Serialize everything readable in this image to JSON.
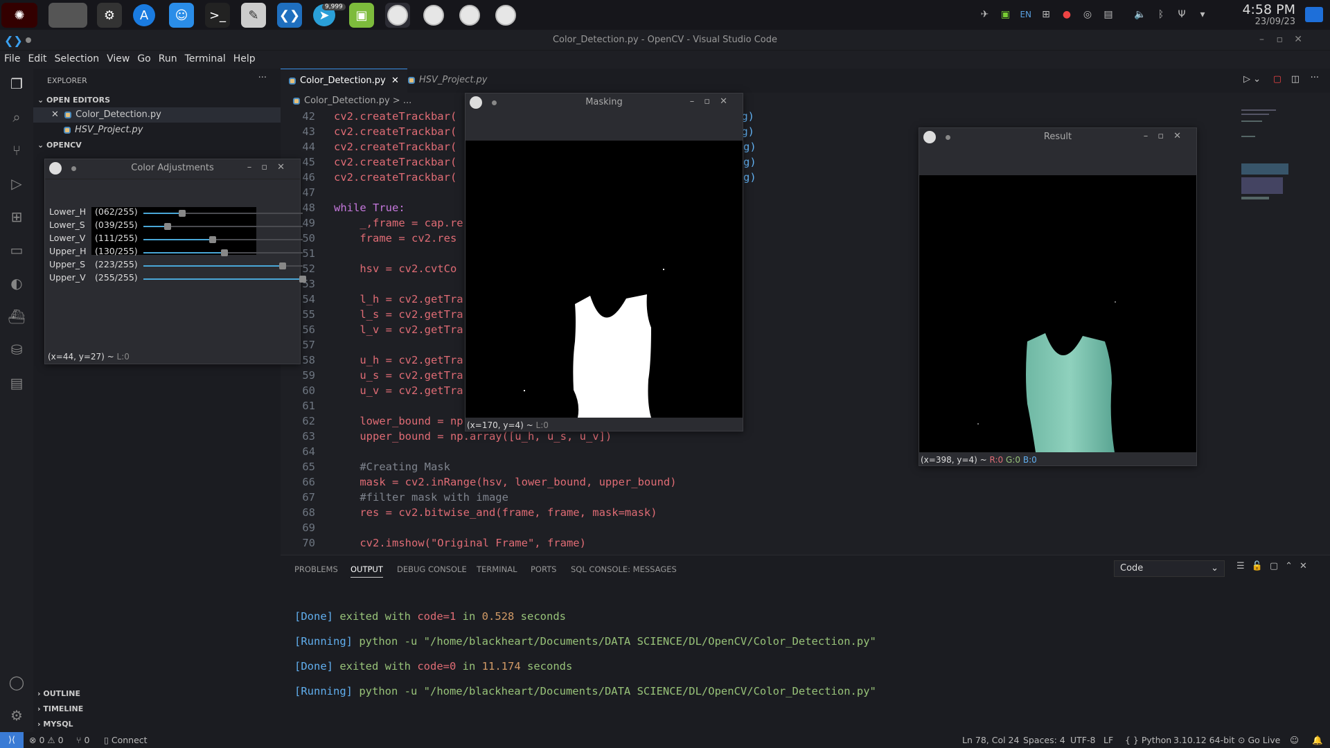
{
  "taskbar": {
    "badge": "9,999",
    "lang": "EN",
    "clock_time": "4:58 PM",
    "clock_date": "23/09/23"
  },
  "window": {
    "title": "Color_Detection.py - OpenCV - Visual Studio Code"
  },
  "menu": [
    "File",
    "Edit",
    "Selection",
    "View",
    "Go",
    "Run",
    "Terminal",
    "Help"
  ],
  "sidebar": {
    "header": "EXPLORER",
    "open_editors": "OPEN EDITORS",
    "files": [
      "Color_Detection.py",
      "HSV_Project.py"
    ],
    "folder": "OPENCV",
    "outline": "OUTLINE",
    "timeline": "TIMELINE",
    "mysql": "MYSQL"
  },
  "tabs": [
    "Color_Detection.py",
    "HSV_Project.py"
  ],
  "breadcrumb": "Color_Detection.py > ...",
  "code_lines": [
    {
      "n": "42",
      "t": "cv2.createTrackbar(",
      "tail": "thing)"
    },
    {
      "n": "43",
      "t": "cv2.createTrackbar(",
      "tail": "thing)"
    },
    {
      "n": "44",
      "t": "cv2.createTrackbar(",
      "tail": "nothing)"
    },
    {
      "n": "45",
      "t": "cv2.createTrackbar(",
      "tail": "nothing)"
    },
    {
      "n": "46",
      "t": "cv2.createTrackbar(",
      "tail": "nothing)"
    },
    {
      "n": "47",
      "t": ""
    },
    {
      "n": "48",
      "t": "while True:"
    },
    {
      "n": "49",
      "t": "    _,frame = cap.re"
    },
    {
      "n": "50",
      "t": "    frame = cv2.res"
    },
    {
      "n": "51",
      "t": ""
    },
    {
      "n": "52",
      "t": "    hsv = cv2.cvtCo"
    },
    {
      "n": "53",
      "t": ""
    },
    {
      "n": "54",
      "t": "    l_h = cv2.getTra"
    },
    {
      "n": "55",
      "t": "    l_s = cv2.getTra"
    },
    {
      "n": "56",
      "t": "    l_v = cv2.getTra"
    },
    {
      "n": "57",
      "t": ""
    },
    {
      "n": "58",
      "t": "    u_h = cv2.getTra"
    },
    {
      "n": "59",
      "t": "    u_s = cv2.getTra"
    },
    {
      "n": "60",
      "t": "    u_v = cv2.getTra"
    },
    {
      "n": "61",
      "t": ""
    },
    {
      "n": "62",
      "t": "    lower_bound = np"
    },
    {
      "n": "63",
      "t": "    upper_bound = np.array([u_h, u_s, u_v])"
    },
    {
      "n": "64",
      "t": ""
    },
    {
      "n": "65",
      "t": "    #Creating Mask"
    },
    {
      "n": "66",
      "t": "    mask = cv2.inRange(hsv, lower_bound, upper_bound)"
    },
    {
      "n": "67",
      "t": "    #filter mask with image"
    },
    {
      "n": "68",
      "t": "    res = cv2.bitwise_and(frame, frame, mask=mask)"
    },
    {
      "n": "69",
      "t": ""
    },
    {
      "n": "70",
      "t": "    cv2.imshow(\"Original Frame\", frame)"
    }
  ],
  "panel": {
    "tabs": [
      "PROBLEMS",
      "OUTPUT",
      "DEBUG CONSOLE",
      "TERMINAL",
      "PORTS",
      "SQL CONSOLE: MESSAGES"
    ],
    "dropdown": "Code",
    "lines": [
      {
        "tag": "[Done]",
        "rest": " exited with ",
        "code": "code=1",
        "tail": " in ",
        "num": "0.528",
        "end": " seconds"
      },
      {
        "tag": "[Running]",
        "rest": " python -u \"/home/blackheart/Documents/DATA SCIENCE/DL/OpenCV/Color_Detection.py\""
      },
      {
        "tag": "[Done]",
        "rest": " exited with ",
        "code": "code=0",
        "tail": " in ",
        "num": "11.174",
        "end": " seconds"
      },
      {
        "tag": "[Running]",
        "rest": " python -u \"/home/blackheart/Documents/DATA SCIENCE/DL/OpenCV/Color_Detection.py\""
      }
    ]
  },
  "status": {
    "errors": "0",
    "warnings": "0",
    "ports": "0",
    "connect": "Connect",
    "position": "Ln 78, Col 24",
    "spaces": "Spaces: 4",
    "encoding": "UTF-8",
    "eol": "LF",
    "language": "Python",
    "interpreter": "3.10.12 64-bit",
    "golive": "Go Live"
  },
  "adjust_win": {
    "title": "Color Adjustments",
    "sliders": [
      {
        "label": "Lower_H",
        "value": "(062/255)",
        "frac": 0.243
      },
      {
        "label": "Lower_S",
        "value": "(039/255)",
        "frac": 0.153
      },
      {
        "label": "Lower_V",
        "value": "(111/255)",
        "frac": 0.435
      },
      {
        "label": "Upper_H",
        "value": "(130/255)",
        "frac": 0.51
      },
      {
        "label": "Upper_S",
        "value": "(223/255)",
        "frac": 0.875
      },
      {
        "label": "Upper_V",
        "value": "(255/255)",
        "frac": 1.0
      }
    ],
    "coord": "(x=44, y=27) ~",
    "coord_tail": "L:0"
  },
  "mask_win": {
    "title": "Masking",
    "coord": "(x=170, y=4) ~",
    "coord_tail": "L:0"
  },
  "result_win": {
    "title": "Result",
    "coord": "(x=398, y=4) ~",
    "r": "R:0",
    "g": "G:0",
    "b": "B:0"
  }
}
